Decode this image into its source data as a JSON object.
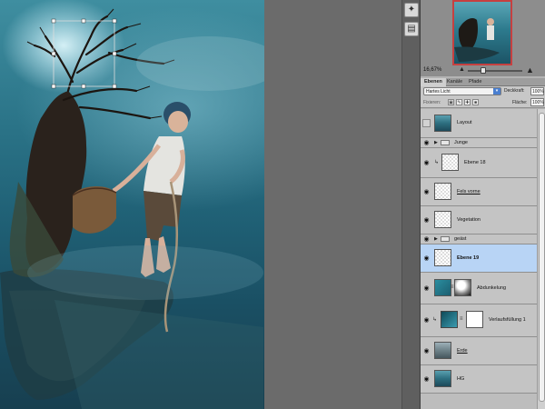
{
  "navigator": {
    "zoom": "16,67%"
  },
  "layers_panel": {
    "tabs": [
      "Ebenen",
      "Kanäle",
      "Pfade"
    ],
    "active_tab": "Ebenen",
    "blend_mode": "Hartes Licht",
    "opacity_label": "Deckkraft:",
    "opacity_value": "100%",
    "lock_label": "Fixieren:",
    "fill_label": "Fläche:",
    "fill_value": "100%",
    "layers": [
      {
        "name": "Layout",
        "visible": false,
        "type": "pixel"
      },
      {
        "name": "Junge",
        "visible": true,
        "type": "group"
      },
      {
        "name": "Ebene 18",
        "visible": true,
        "type": "pixel-clipped"
      },
      {
        "name": "Fels vorne",
        "visible": true,
        "type": "pixel",
        "underlined": true
      },
      {
        "name": "Vegetation",
        "visible": true,
        "type": "pixel"
      },
      {
        "name": "geäst",
        "visible": true,
        "type": "group"
      },
      {
        "name": "Ebene 19",
        "visible": true,
        "type": "pixel",
        "selected": true
      },
      {
        "name": "Abdunkelung",
        "visible": true,
        "type": "pixel-mask"
      },
      {
        "name": "Verlaufsfüllung 1",
        "visible": true,
        "type": "gradient-fill"
      },
      {
        "name": "Erde",
        "visible": true,
        "type": "pixel",
        "underlined": true
      },
      {
        "name": "HG",
        "visible": true,
        "type": "pixel"
      }
    ]
  },
  "colors": {
    "selection": "#b8d4f5",
    "panel_bg": "#bdbdbd",
    "nav_border": "#c64040"
  }
}
